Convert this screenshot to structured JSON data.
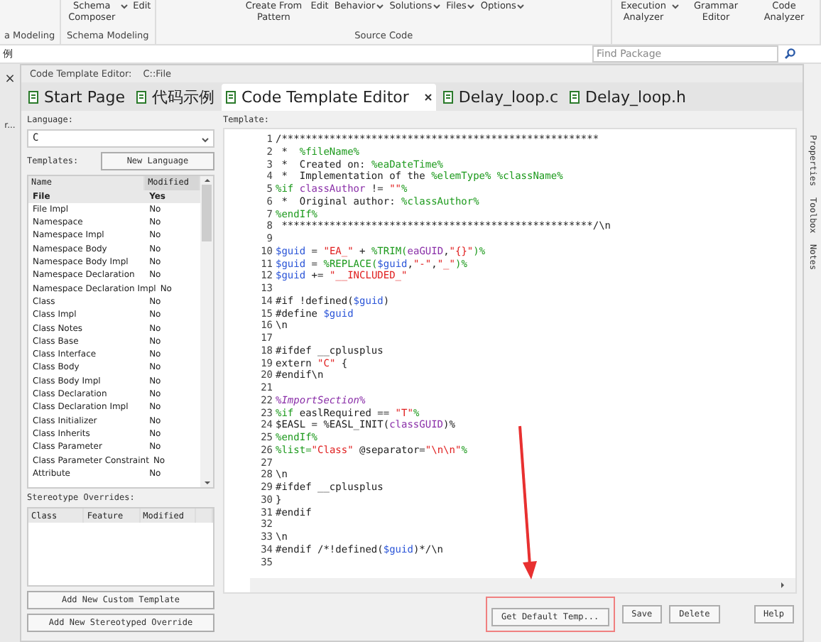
{
  "ribbon": {
    "groups": [
      {
        "label": "a Modeling"
      },
      {
        "label": "Schema Modeling",
        "items": [
          {
            "label": "Schema Composer",
            "dropdown": true
          },
          {
            "label": "Edit",
            "dropdown": false
          }
        ]
      },
      {
        "label": "Source Code",
        "items": [
          {
            "label": "Create From Pattern",
            "dropdown": false
          },
          {
            "label": "Edit",
            "dropdown": false
          },
          {
            "label": "Behavior",
            "dropdown": true
          },
          {
            "label": "Solutions",
            "dropdown": true
          },
          {
            "label": "Files",
            "dropdown": true
          },
          {
            "label": "Options",
            "dropdown": true
          }
        ]
      },
      {
        "items": [
          {
            "label": "Execution Analyzer",
            "dropdown": true
          },
          {
            "label": "Grammar Editor",
            "dropdown": false
          },
          {
            "label": "Code Analyzer",
            "dropdown": false
          }
        ]
      }
    ]
  },
  "address_bar": {
    "path": "例",
    "search": {
      "placeholder": "Find Package"
    }
  },
  "left_panel": {
    "close": "×",
    "caption": "r..."
  },
  "panel": {
    "title": "Code Template Editor:",
    "path": "C::File"
  },
  "tabs": [
    {
      "label": "Start Page",
      "selected": false
    },
    {
      "label": "代码示例",
      "selected": false
    },
    {
      "label": "Code Template Editor",
      "selected": true
    },
    {
      "label": "Delay_loop.c",
      "selected": false
    },
    {
      "label": "Delay_loop.h",
      "selected": false
    }
  ],
  "side_tabs": [
    "Properties",
    "Toolbox",
    "Notes"
  ],
  "language": {
    "label": "Language:",
    "value": "C"
  },
  "templates": {
    "label": "Templates:",
    "new_button": "New Language",
    "columns": [
      "Name",
      "Modified"
    ],
    "rows": [
      {
        "name": "File",
        "modified": "Yes",
        "selected": true
      },
      {
        "name": "File Impl",
        "modified": "No",
        "selected": false
      },
      {
        "name": "Namespace",
        "modified": "No",
        "selected": false
      },
      {
        "name": "Namespace Impl",
        "modified": "No",
        "selected": false
      },
      {
        "name": "Namespace Body",
        "modified": "No",
        "selected": false
      },
      {
        "name": "Namespace Body Impl",
        "modified": "No",
        "selected": false
      },
      {
        "name": "Namespace Declaration",
        "modified": "No",
        "selected": false
      },
      {
        "name": "Namespace Declaration Impl",
        "modified": "No",
        "selected": false
      },
      {
        "name": "Class",
        "modified": "No",
        "selected": false
      },
      {
        "name": "Class Impl",
        "modified": "No",
        "selected": false
      },
      {
        "name": "Class Notes",
        "modified": "No",
        "selected": false
      },
      {
        "name": "Class Base",
        "modified": "No",
        "selected": false
      },
      {
        "name": "Class Interface",
        "modified": "No",
        "selected": false
      },
      {
        "name": "Class Body",
        "modified": "No",
        "selected": false
      },
      {
        "name": "Class Body Impl",
        "modified": "No",
        "selected": false
      },
      {
        "name": "Class Declaration",
        "modified": "No",
        "selected": false
      },
      {
        "name": "Class Declaration Impl",
        "modified": "No",
        "selected": false
      },
      {
        "name": "Class Initializer",
        "modified": "No",
        "selected": false
      },
      {
        "name": "Class Inherits",
        "modified": "No",
        "selected": false
      },
      {
        "name": "Class Parameter",
        "modified": "No",
        "selected": false
      },
      {
        "name": "Class Parameter Constraint",
        "modified": "No",
        "selected": false
      },
      {
        "name": "Attribute",
        "modified": "No",
        "selected": false
      }
    ]
  },
  "stereotype_overrides": {
    "label": "Stereotype Overrides:",
    "columns": [
      "Class",
      "Feature",
      "Modified"
    ]
  },
  "left_buttons": [
    "Add New Custom Template",
    "Add New Stereotyped Override"
  ],
  "template": {
    "label": "Template:",
    "lines": [
      {
        "number": "1",
        "tokens": [
          {
            "kind": "text",
            "text": "/*****************************************************"
          }
        ]
      },
      {
        "number": "2",
        "tokens": [
          {
            "kind": "text",
            "text": " *  "
          },
          {
            "kind": "macro",
            "text": "%fileName%"
          }
        ]
      },
      {
        "number": "3",
        "tokens": [
          {
            "kind": "text",
            "text": " *  Created on: "
          },
          {
            "kind": "macro",
            "text": "%eaDateTime%"
          }
        ]
      },
      {
        "number": "4",
        "tokens": [
          {
            "kind": "text",
            "text": " *  Implementation of the "
          },
          {
            "kind": "macro",
            "text": "%elemType% %className%"
          }
        ]
      },
      {
        "number": "5",
        "tokens": [
          {
            "kind": "macro",
            "text": "%if "
          },
          {
            "kind": "attr",
            "text": "classAuthor"
          },
          {
            "kind": "text",
            "text": " != "
          },
          {
            "kind": "str",
            "text": "\"\""
          },
          {
            "kind": "macro",
            "text": "%"
          }
        ]
      },
      {
        "number": "6",
        "tokens": [
          {
            "kind": "text",
            "text": " *  Original author: "
          },
          {
            "kind": "macro",
            "text": "%classAuthor%"
          }
        ]
      },
      {
        "number": "7",
        "tokens": [
          {
            "kind": "macro",
            "text": "%endIf%"
          }
        ]
      },
      {
        "number": "8",
        "tokens": [
          {
            "kind": "text",
            "text": " ****************************************************/\\n"
          }
        ]
      },
      {
        "number": "9"
      },
      {
        "number": "10",
        "tokens": [
          {
            "kind": "var",
            "text": "$guid"
          },
          {
            "kind": "text",
            "text": " = "
          },
          {
            "kind": "str",
            "text": "\"EA_\""
          },
          {
            "kind": "text",
            "text": " + "
          },
          {
            "kind": "macro",
            "text": "%TRIM("
          },
          {
            "kind": "attr",
            "text": "eaGUID"
          },
          {
            "kind": "text",
            "text": ","
          },
          {
            "kind": "str",
            "text": "\"{}\""
          },
          {
            "kind": "macro",
            "text": ")%"
          }
        ]
      },
      {
        "number": "11",
        "tokens": [
          {
            "kind": "var",
            "text": "$guid"
          },
          {
            "kind": "text",
            "text": " = "
          },
          {
            "kind": "macro",
            "text": "%REPLACE("
          },
          {
            "kind": "var",
            "text": "$guid"
          },
          {
            "kind": "text",
            "text": ","
          },
          {
            "kind": "str",
            "text": "\"-\""
          },
          {
            "kind": "text",
            "text": ","
          },
          {
            "kind": "str",
            "text": "\"_\""
          },
          {
            "kind": "macro",
            "text": ")%"
          }
        ]
      },
      {
        "number": "12",
        "tokens": [
          {
            "kind": "var",
            "text": "$guid"
          },
          {
            "kind": "text",
            "text": " += "
          },
          {
            "kind": "str",
            "text": "\"__INCLUDED_\""
          }
        ]
      },
      {
        "number": "13"
      },
      {
        "number": "14",
        "tokens": [
          {
            "kind": "text",
            "text": "#if !defined("
          },
          {
            "kind": "var",
            "text": "$guid"
          },
          {
            "kind": "text",
            "text": ")"
          }
        ]
      },
      {
        "number": "15",
        "tokens": [
          {
            "kind": "text",
            "text": "#define "
          },
          {
            "kind": "var",
            "text": "$guid"
          }
        ]
      },
      {
        "number": "16",
        "tokens": [
          {
            "kind": "text",
            "text": "\\n"
          }
        ]
      },
      {
        "number": "17"
      },
      {
        "number": "18",
        "tokens": [
          {
            "kind": "text",
            "text": "#ifdef __cplusplus"
          }
        ]
      },
      {
        "number": "19",
        "tokens": [
          {
            "kind": "text",
            "text": "extern "
          },
          {
            "kind": "str",
            "text": "\"C\""
          },
          {
            "kind": "text",
            "text": " {"
          }
        ]
      },
      {
        "number": "20",
        "tokens": [
          {
            "kind": "text",
            "text": "#endif\\n"
          }
        ]
      },
      {
        "number": "21"
      },
      {
        "number": "22",
        "tokens": [
          {
            "kind": "section",
            "text": "%ImportSection%"
          }
        ]
      },
      {
        "number": "23",
        "tokens": [
          {
            "kind": "macro",
            "text": "%if "
          },
          {
            "kind": "text",
            "text": "easlRequired == "
          },
          {
            "kind": "str",
            "text": "\"T\""
          },
          {
            "kind": "macro",
            "text": "%"
          }
        ]
      },
      {
        "number": "24",
        "tokens": [
          {
            "kind": "text",
            "text": "$EASL = %EASL_INIT("
          },
          {
            "kind": "attr",
            "text": "classGUID"
          },
          {
            "kind": "text",
            "text": ")%"
          }
        ]
      },
      {
        "number": "25",
        "tokens": [
          {
            "kind": "macro",
            "text": "%endIf%"
          }
        ]
      },
      {
        "number": "26",
        "tokens": [
          {
            "kind": "macro",
            "text": "%list="
          },
          {
            "kind": "str",
            "text": "\"Class\""
          },
          {
            "kind": "text",
            "text": " @separator="
          },
          {
            "kind": "str",
            "text": "\"\\n\\n\""
          },
          {
            "kind": "macro",
            "text": "%"
          }
        ]
      },
      {
        "number": "27"
      },
      {
        "number": "28",
        "tokens": [
          {
            "kind": "text",
            "text": "\\n"
          }
        ]
      },
      {
        "number": "29",
        "tokens": [
          {
            "kind": "text",
            "text": "#ifdef __cplusplus"
          }
        ]
      },
      {
        "number": "30",
        "tokens": [
          {
            "kind": "text",
            "text": "}"
          }
        ]
      },
      {
        "number": "31",
        "tokens": [
          {
            "kind": "text",
            "text": "#endif"
          }
        ]
      },
      {
        "number": "32"
      },
      {
        "number": "33",
        "tokens": [
          {
            "kind": "text",
            "text": "\\n"
          }
        ]
      },
      {
        "number": "34",
        "tokens": [
          {
            "kind": "text",
            "text": "#endif /*!defined("
          },
          {
            "kind": "var",
            "text": "$guid"
          },
          {
            "kind": "text",
            "text": ")*/\\n"
          }
        ]
      },
      {
        "number": "35"
      }
    ]
  },
  "buttons": [
    "Get Default Temp...",
    "Save",
    "Delete",
    "Help"
  ]
}
